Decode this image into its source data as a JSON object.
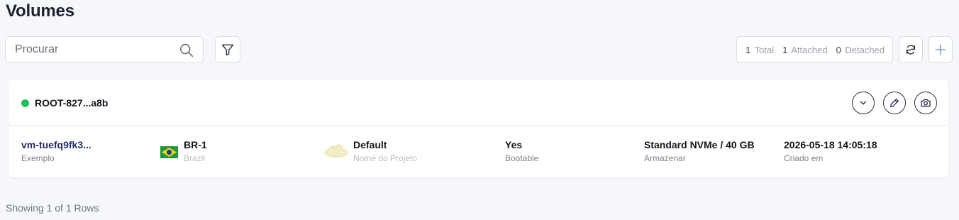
{
  "page": {
    "title": "Volumes"
  },
  "toolbar": {
    "search_placeholder": "Procurar",
    "stats": [
      {
        "count": "1",
        "label": "Total"
      },
      {
        "count": "1",
        "label": "Attached"
      },
      {
        "count": "0",
        "label": "Detached"
      }
    ]
  },
  "volume": {
    "status_color": "#1ec25a",
    "name": "ROOT-827...a8b",
    "vm": {
      "value": "vm-tuefq9fk3...",
      "label": "Exemplo"
    },
    "region": {
      "value": "BR-1",
      "label": "Brazil"
    },
    "project": {
      "value": "Default",
      "label": "Nome do Projeto"
    },
    "bootable": {
      "value": "Yes",
      "label": "Bootable"
    },
    "storage": {
      "value": "Standard NVMe / 40 GB",
      "label": "Armazenar"
    },
    "created": {
      "value": "2026-05-18 14:05:18",
      "label": "Criado em"
    }
  },
  "footer": {
    "text": "Showing 1 of 1 Rows"
  },
  "icons": {
    "search": "search-icon",
    "filter": "filter-icon",
    "refresh": "refresh-icon",
    "add": "plus-icon",
    "expand": "chevron-down-icon",
    "edit": "pencil-icon",
    "snapshot": "camera-icon"
  },
  "colors": {
    "accent": "#2a2f45",
    "status_ok": "#1ec25a",
    "link": "#262a6c"
  }
}
